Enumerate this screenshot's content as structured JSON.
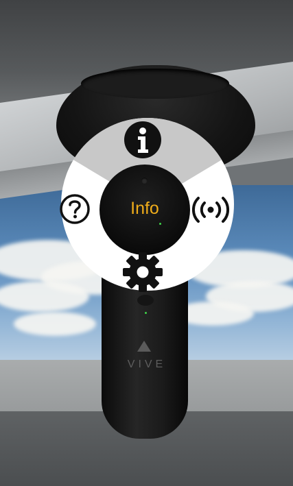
{
  "radial_menu": {
    "center_label": "Info",
    "center_label_color": "#f0ad1a",
    "items": [
      {
        "name": "info",
        "icon": "info-icon",
        "position": "top"
      },
      {
        "name": "help",
        "icon": "question-mark-icon",
        "position": "left"
      },
      {
        "name": "broadcast",
        "icon": "broadcast-icon",
        "position": "right"
      },
      {
        "name": "settings",
        "icon": "gear-icon",
        "position": "bottom"
      }
    ]
  },
  "controller": {
    "brand_text": "VIVE"
  },
  "colors": {
    "menu_background": "#ffffff",
    "selected_wedge": "#c8c8c8",
    "icon_color": "#111111"
  }
}
